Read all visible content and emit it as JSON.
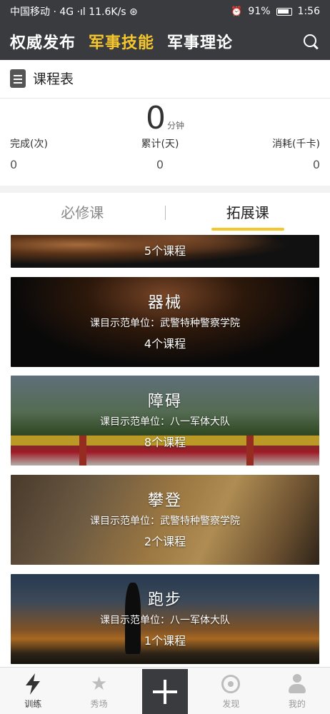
{
  "status_bar": {
    "left_text": "中国移动 · 4G ·ıl 11.6K/s ⊛",
    "battery": "91%",
    "time": "1:56"
  },
  "header": {
    "tabs": [
      {
        "label": "权威发布"
      },
      {
        "label": "军事技能"
      },
      {
        "label": "军事理论"
      }
    ],
    "active_tab": "军事技能"
  },
  "schedule": {
    "title": "课程表",
    "total_value": "0",
    "total_unit": "分钟",
    "stats": [
      {
        "label": "完成(次)",
        "value": "0"
      },
      {
        "label": "累计(天)",
        "value": "0"
      },
      {
        "label": "消耗(千卡)",
        "value": "0"
      }
    ]
  },
  "course_tabs": {
    "items": [
      {
        "label": "必修课"
      },
      {
        "label": "拓展课"
      }
    ],
    "active": "拓展课"
  },
  "courses": [
    {
      "name": "",
      "unit": "",
      "count": "5个课程"
    },
    {
      "name": "器械",
      "unit": "课目示范单位：武警特种警察学院",
      "count": "4个课程"
    },
    {
      "name": "障碍",
      "unit": "课目示范单位：八一军体大队",
      "count": "8个课程"
    },
    {
      "name": "攀登",
      "unit": "课目示范单位：武警特种警察学院",
      "count": "2个课程"
    },
    {
      "name": "跑步",
      "unit": "课目示范单位：八一军体大队",
      "count": "1个课程"
    }
  ],
  "tabbar": {
    "items": [
      {
        "label": "训练",
        "icon": "lightning-icon"
      },
      {
        "label": "秀场",
        "icon": "star-icon"
      },
      {
        "label": "",
        "icon": "plus-icon"
      },
      {
        "label": "发现",
        "icon": "discover-icon"
      },
      {
        "label": "我的",
        "icon": "profile-icon"
      }
    ],
    "active": "训练"
  },
  "colors": {
    "header_bg": "#3a3b3f",
    "accent": "#f6c72c"
  }
}
